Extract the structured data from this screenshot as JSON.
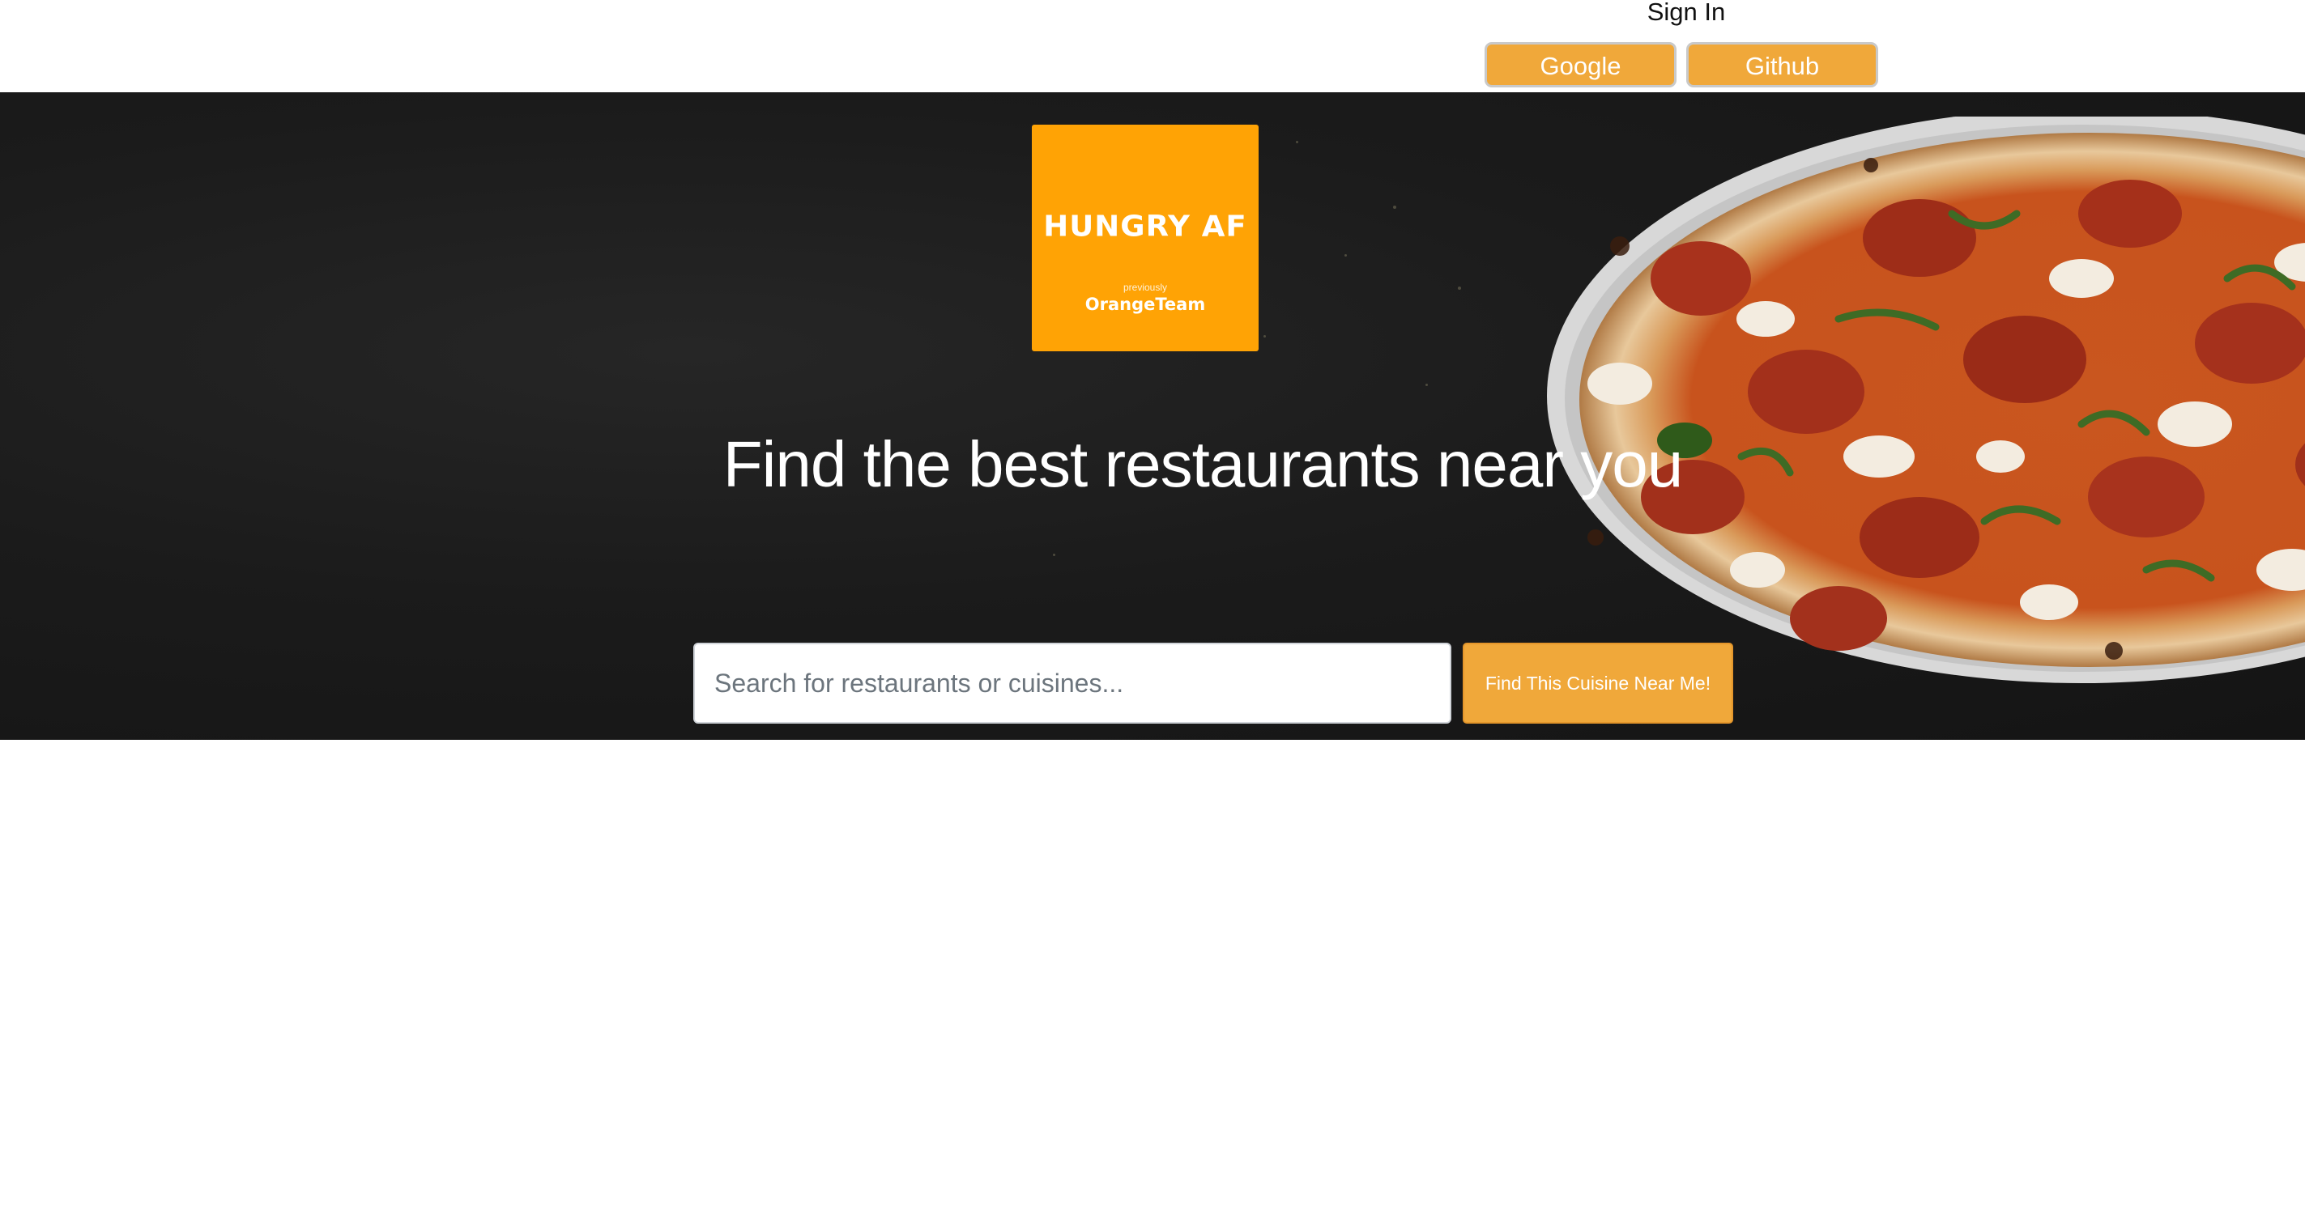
{
  "header": {
    "signin_label": "Sign In",
    "google_label": "Google",
    "github_label": "Github"
  },
  "logo": {
    "title": "HUNGRY AF",
    "subtitle": "previously",
    "team": "OrangeTeam"
  },
  "hero": {
    "headline": "Find the best restaurants near you",
    "search_placeholder": "Search for restaurants or cuisines...",
    "search_value": "",
    "search_button_label": "Find This Cuisine Near Me!"
  },
  "colors": {
    "accent": "#f0a83a",
    "logo_bg": "#ffa305",
    "hero_bg": "#1b1b1b"
  }
}
